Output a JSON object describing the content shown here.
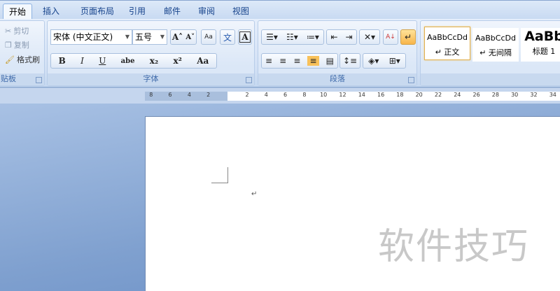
{
  "tabs": [
    "开始",
    "插入",
    "页面布局",
    "引用",
    "邮件",
    "审阅",
    "视图"
  ],
  "clipboard": {
    "cut": "剪切",
    "copy": "复制",
    "format_painter": "格式刷",
    "label": "贴板"
  },
  "font": {
    "name": "宋体 (中文正文)",
    "size": "五号",
    "label": "字体",
    "bold": "B",
    "italic": "I",
    "underline": "U",
    "strike": "abe",
    "sub": "x₂",
    "sup": "x²",
    "case": "Aa",
    "grow": "A˄",
    "shrink": "A˅",
    "color_a": "A",
    "shade_a": "A",
    "enclose": "字",
    "phonetic": "文",
    "clear": "Aa"
  },
  "paragraph": {
    "label": "段落"
  },
  "styles": [
    {
      "preview": "AaBbCcDd",
      "name": "↵ 正文"
    },
    {
      "preview": "AaBbCcDd",
      "name": "↵ 无间隔"
    },
    {
      "preview": "AaBb",
      "name": "标题 1"
    }
  ],
  "ruler": {
    "left": [
      "8",
      "6",
      "4",
      "2"
    ],
    "right": [
      "2",
      "4",
      "6",
      "8",
      "10",
      "12",
      "14",
      "16",
      "18",
      "20",
      "22",
      "24",
      "26",
      "28",
      "30",
      "32",
      "34"
    ]
  },
  "document": {
    "paragraph_mark": "↵",
    "watermark": "软件技巧"
  }
}
